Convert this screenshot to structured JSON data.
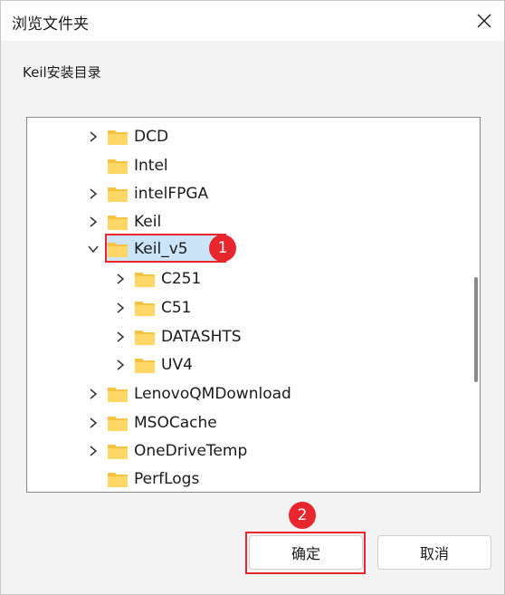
{
  "dialog": {
    "title": "浏览文件夹",
    "description": "Keil安装目录",
    "ok_label": "确定",
    "cancel_label": "取消"
  },
  "tree": [
    {
      "label": "DCD",
      "expander": "collapsed"
    },
    {
      "label": "Intel",
      "expander": "none"
    },
    {
      "label": "intelFPGA",
      "expander": "collapsed"
    },
    {
      "label": "Keil",
      "expander": "collapsed"
    },
    {
      "label": "Keil_v5",
      "expander": "expanded",
      "selected": true
    },
    {
      "label": "C251",
      "expander": "collapsed"
    },
    {
      "label": "C51",
      "expander": "collapsed"
    },
    {
      "label": "DATASHTS",
      "expander": "collapsed"
    },
    {
      "label": "UV4",
      "expander": "collapsed"
    },
    {
      "label": "LenovoQMDownload",
      "expander": "collapsed"
    },
    {
      "label": "MSOCache",
      "expander": "collapsed"
    },
    {
      "label": "OneDriveTemp",
      "expander": "collapsed"
    },
    {
      "label": "PerfLogs",
      "expander": "none"
    }
  ],
  "annotations": {
    "step1": "1",
    "step2": "2"
  },
  "colors": {
    "highlight": "#e8262d",
    "selection": "#cce4f7",
    "folder": "#f5c242"
  }
}
